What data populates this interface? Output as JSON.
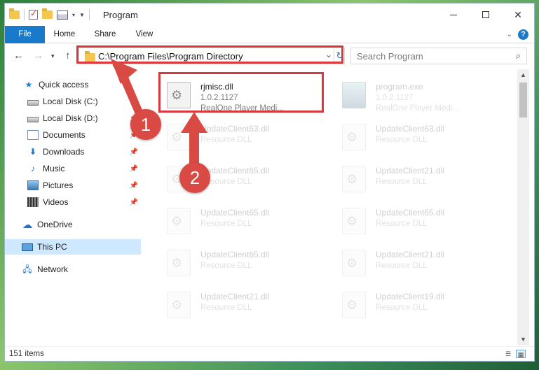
{
  "window": {
    "title": "Program"
  },
  "ribbon": {
    "tabs": [
      {
        "label": "File"
      },
      {
        "label": "Home"
      },
      {
        "label": "Share"
      },
      {
        "label": "View"
      }
    ],
    "help_label": "?"
  },
  "navbar": {
    "address": "C:\\Program Files\\Program Directory",
    "search_placeholder": "Search Program"
  },
  "sidebar": {
    "items": [
      {
        "label": "Quick access",
        "icon": "star-icon",
        "pinned": false
      },
      {
        "label": "Local Disk (C:)",
        "icon": "drive-icon",
        "pinned": true
      },
      {
        "label": "Local Disk (D:)",
        "icon": "drive-icon",
        "pinned": true
      },
      {
        "label": "Documents",
        "icon": "documents-icon",
        "pinned": true
      },
      {
        "label": "Downloads",
        "icon": "download-icon",
        "pinned": true
      },
      {
        "label": "Music",
        "icon": "music-icon",
        "pinned": true
      },
      {
        "label": "Pictures",
        "icon": "pictures-icon",
        "pinned": true
      },
      {
        "label": "Videos",
        "icon": "videos-icon",
        "pinned": true
      },
      {
        "label": "OneDrive",
        "icon": "cloud-icon",
        "pinned": false
      },
      {
        "label": "This PC",
        "icon": "computer-icon",
        "pinned": false,
        "selected": true
      },
      {
        "label": "Network",
        "icon": "network-icon",
        "pinned": false
      }
    ]
  },
  "files": [
    {
      "name": "rjmisc.dll",
      "line1": "1.0.2.1127",
      "line2": "RealOne Player Medi...",
      "highlighted": true
    },
    {
      "name": "program.exe",
      "line1": "1.0.2.1127",
      "line2": "RealOne Player Medi...",
      "highlighted": false
    },
    {
      "name": "UpdateClient63.dll",
      "line1": "Resource DLL",
      "highlighted": false
    },
    {
      "name": "UpdateClient63.dll",
      "line1": "Resource DLL",
      "highlighted": false
    },
    {
      "name": "UpdateClient65.dll",
      "line1": "Resource DLL",
      "highlighted": false
    },
    {
      "name": "UpdateClient21.dll",
      "line1": "Resource DLL",
      "highlighted": false
    },
    {
      "name": "UpdateClient65.dll",
      "line1": "Resource DLL",
      "highlighted": false
    },
    {
      "name": "UpdateClient65.dll",
      "line1": "Resource DLL",
      "highlighted": false
    },
    {
      "name": "UpdateClient65.dll",
      "line1": "Resource DLL",
      "highlighted": false
    },
    {
      "name": "UpdateClient21.dll",
      "line1": "Resource DLL",
      "highlighted": false
    },
    {
      "name": "UpdateClient21.dll",
      "line1": "Resource DLL",
      "highlighted": false
    },
    {
      "name": "UpdateClient19.dll",
      "line1": "Resource DLL",
      "highlighted": false
    }
  ],
  "statusbar": {
    "items_count": "151 items"
  },
  "annotations": {
    "callouts": [
      {
        "label": "1"
      },
      {
        "label": "2"
      }
    ],
    "highlight_color": "#d9393d",
    "badge_color": "#d94a44"
  },
  "colors": {
    "accent": "#1979ca",
    "selection": "#cde8ff"
  }
}
